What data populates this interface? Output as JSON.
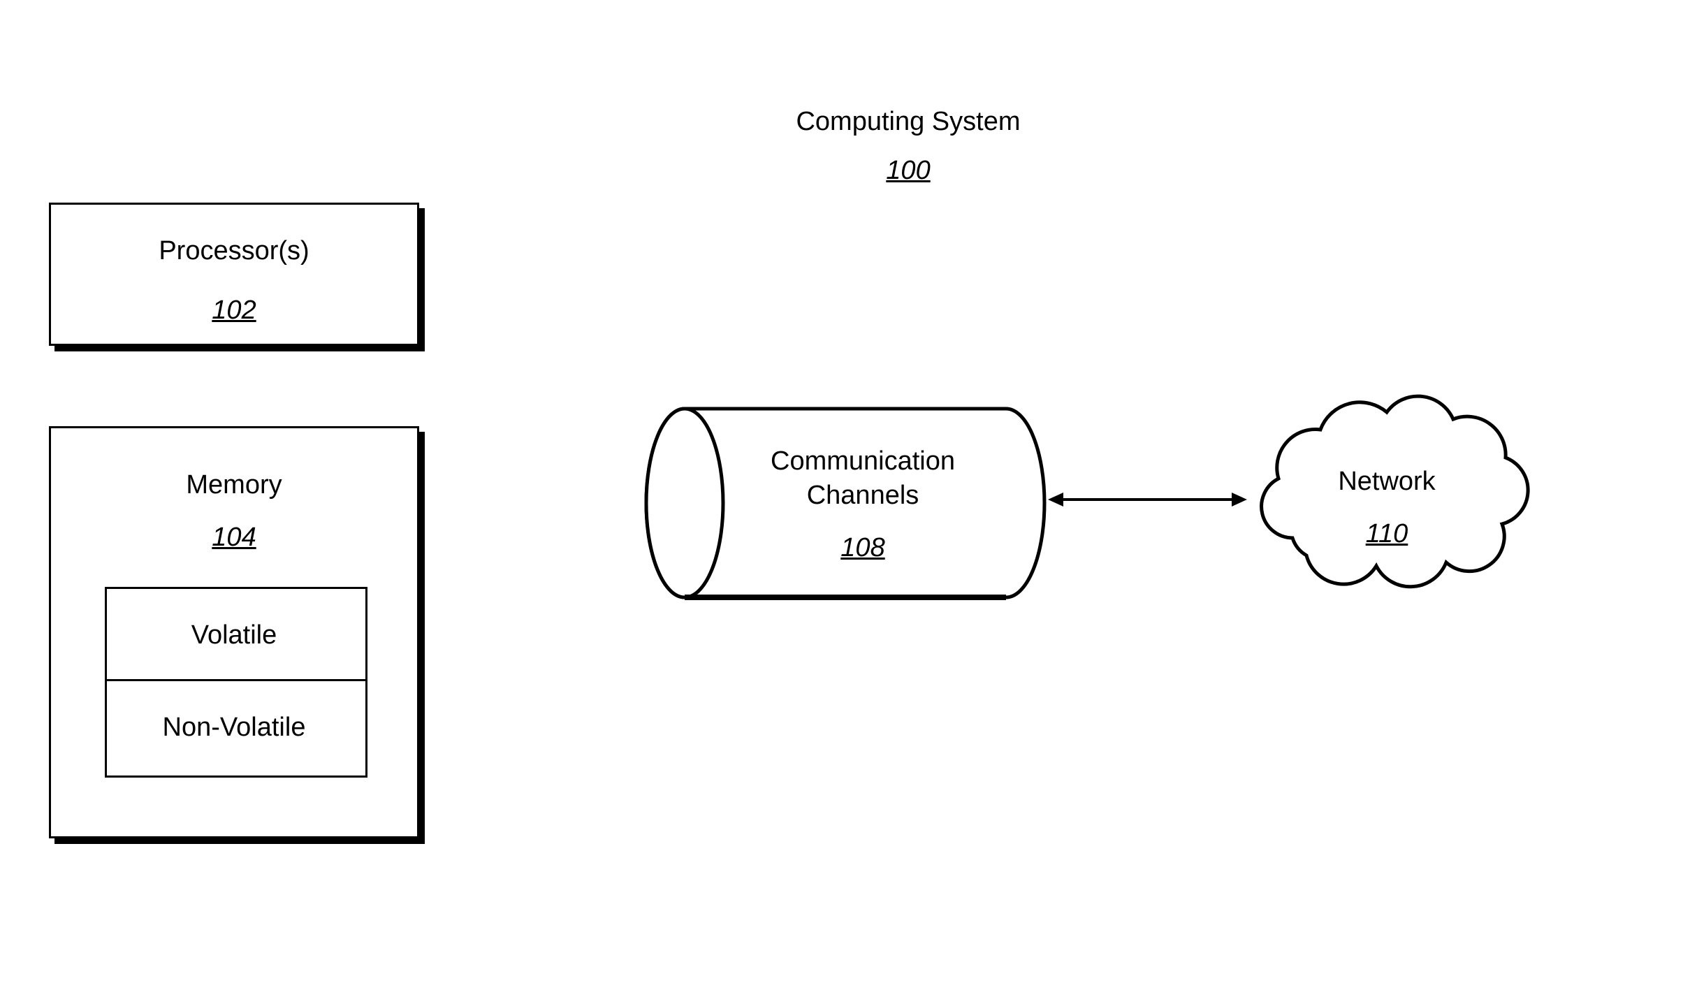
{
  "title": {
    "label": "Computing System",
    "ref": "100"
  },
  "processor": {
    "label": "Processor(s)",
    "ref": "102"
  },
  "memory": {
    "label": "Memory",
    "ref": "104",
    "volatile": "Volatile",
    "nonvolatile": "Non-Volatile"
  },
  "comm": {
    "label": "Communication Channels",
    "ref": "108"
  },
  "network": {
    "label": "Network",
    "ref": "110"
  }
}
